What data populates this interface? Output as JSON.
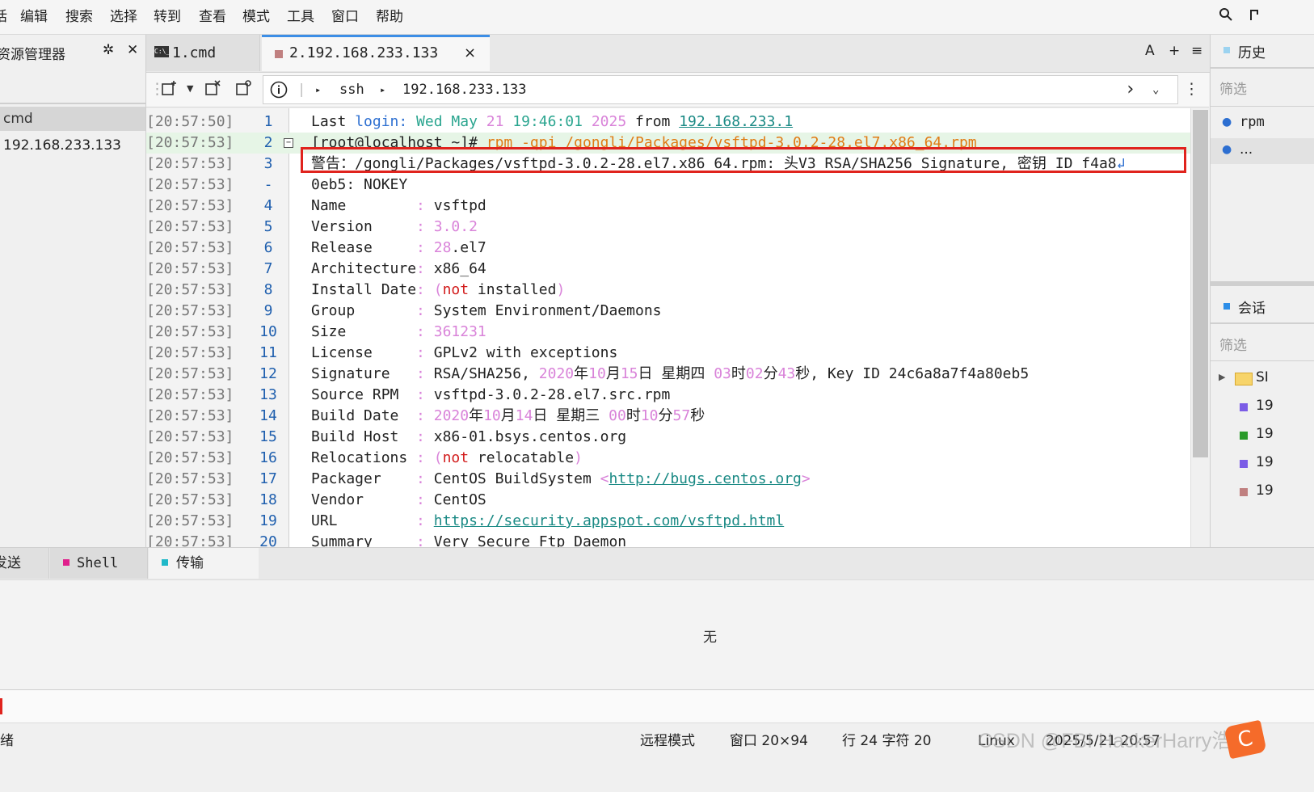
{
  "menubar": {
    "items": [
      "话",
      "编辑",
      "搜索",
      "选择",
      "转到",
      "查看",
      "模式",
      "工具",
      "窗口",
      "帮助"
    ]
  },
  "left_panel": {
    "title": "资源管理器",
    "items": [
      "cmd",
      "192.168.233.133"
    ]
  },
  "tabs": [
    {
      "label": "1.cmd",
      "icon": "C:\\_"
    },
    {
      "label": "2.192.168.233.133",
      "close": "×"
    }
  ],
  "tab_buttons": [
    "A",
    "+",
    "≡"
  ],
  "toolbar": {
    "arrow1": "▸",
    "protocol": "ssh",
    "arrow2": "▸",
    "host": "192.168.233.133"
  },
  "terminal": {
    "lines": [
      {
        "ts": "[20:57:50]",
        "ln": "1"
      },
      {
        "ts": "[20:57:53]",
        "ln": "2"
      },
      {
        "ts": "[20:57:53]",
        "ln": "3"
      },
      {
        "ts": "[20:57:53]",
        "ln": "-"
      },
      {
        "ts": "[20:57:53]",
        "ln": "4"
      },
      {
        "ts": "[20:57:53]",
        "ln": "5"
      },
      {
        "ts": "[20:57:53]",
        "ln": "6"
      },
      {
        "ts": "[20:57:53]",
        "ln": "7"
      },
      {
        "ts": "[20:57:53]",
        "ln": "8"
      },
      {
        "ts": "[20:57:53]",
        "ln": "9"
      },
      {
        "ts": "[20:57:53]",
        "ln": "10"
      },
      {
        "ts": "[20:57:53]",
        "ln": "11"
      },
      {
        "ts": "[20:57:53]",
        "ln": "12"
      },
      {
        "ts": "[20:57:53]",
        "ln": "13"
      },
      {
        "ts": "[20:57:53]",
        "ln": "14"
      },
      {
        "ts": "[20:57:53]",
        "ln": "15"
      },
      {
        "ts": "[20:57:53]",
        "ln": "16"
      },
      {
        "ts": "[20:57:53]",
        "ln": "17"
      },
      {
        "ts": "[20:57:53]",
        "ln": "18"
      },
      {
        "ts": "[20:57:53]",
        "ln": "19"
      },
      {
        "ts": "[20:57:53]",
        "ln": "20"
      }
    ],
    "l1": {
      "a": "Last ",
      "b": "login:",
      "c": " Wed May ",
      "d": "21",
      "e": " 19:46:01 ",
      "f": "2025",
      "g": " from ",
      "h": "192.168.233.1"
    },
    "l2": {
      "a": "[root@localhost ~]# ",
      "b": "rpm -qpi /gongli/Packages/vsftpd-3.0.2-28.el7.x86_64.rpm"
    },
    "l3": "警告：/gongli/Packages/vsftpd-3.0.2-28.el7.x86_64.rpm: 头V3 RSA/SHA256 Signature, 密钥 ID f4a8",
    "l3_more": "↲",
    "l4": {
      "a": "0eb5",
      "b": ": NOKEY"
    },
    "fields": {
      "name_k": "Name        ",
      "name_v": "vsftpd",
      "ver_k": "Version     ",
      "ver_v": "3.0.2",
      "rel_k": "Release     ",
      "rel_v1": "28",
      "rel_v2": ".el7",
      "arch_k": "Architecture",
      "arch_v": "x86_64",
      "idate_k": "Install Date",
      "idate_v1": "not",
      "idate_v2": " installed",
      "group_k": "Group       ",
      "group_v": "System Environment/Daemons",
      "size_k": "Size        ",
      "size_v": "361231",
      "lic_k": "License     ",
      "lic_v": "GPLv2 with exceptions",
      "sig_k": "Signature   ",
      "sig_a": "RSA/SHA256, ",
      "sig_b": "2020",
      "sig_c": "年",
      "sig_d": "10",
      "sig_e": "月",
      "sig_f": "15",
      "sig_g": "日 星期四 ",
      "sig_h": "03",
      "sig_i": "时",
      "sig_j": "02",
      "sig_k2": "分",
      "sig_l": "43",
      "sig_m": "秒, Key ID 24c6a8a7f4a80eb5",
      "src_k": "Source RPM  ",
      "src_v": "vsftpd-3.0.2-28.el7.src.rpm",
      "bd_k": "Build Date  ",
      "bd_a": "2020",
      "bd_b": "年",
      "bd_c": "10",
      "bd_d": "月",
      "bd_e": "14",
      "bd_f": "日 星期三 ",
      "bd_g": "00",
      "bd_h": "时",
      "bd_i": "10",
      "bd_j": "分",
      "bd_k2": "57",
      "bd_l": "秒",
      "bh_k": "Build Host  ",
      "bh_v": "x86-01.bsys.centos.org",
      "rel2_k": "Relocations ",
      "rel2_v1": "not",
      "rel2_v2": " relocatable",
      "pkg_k": "Packager    ",
      "pkg_a": "CentOS BuildSystem ",
      "pkg_b": "http://bugs.centos.org",
      "ven_k": "Vendor      ",
      "ven_v": "CentOS",
      "url_k": "URL         ",
      "url_v": "https://security.appspot.com/vsftpd.html",
      "sum_k": "Summary     ",
      "sum_v": "Very Secure Ftp Daemon"
    }
  },
  "right_panel": {
    "history_title": "历史",
    "filter": "筛选",
    "items": [
      "rpm",
      "..."
    ],
    "session_title": "会话",
    "tree_label": "SI",
    "tree_items": [
      "19",
      "19",
      "19",
      "19"
    ]
  },
  "bottom_tabs": [
    "发送",
    "Shell",
    "传输"
  ],
  "bottom_empty": "无",
  "statusbar": {
    "ready": "绪",
    "mode": "远程模式",
    "window": "窗口 20×94",
    "pos": "行 24 字符 20",
    "os": "Linux",
    "datetime": "2025/5/21 20:57",
    "watermark": "CSDN @FBI HackerHarry浩"
  },
  "colors": {
    "accent": "#3c8ee6",
    "highlight_box": "#e0231d",
    "tab2_marker": "#c08080"
  }
}
